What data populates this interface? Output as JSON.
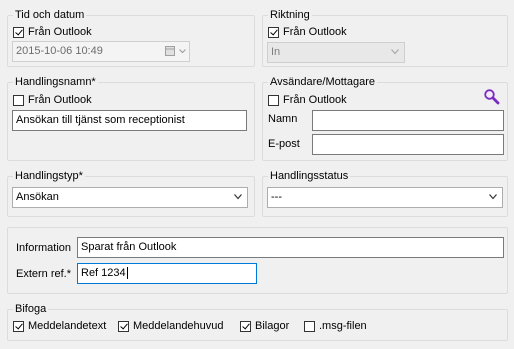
{
  "tid_och_datum": {
    "title": "Tid och datum",
    "from_outlook_label": "Från Outlook",
    "from_outlook_checked": true,
    "datetime_value": "2015-10-06 10:49"
  },
  "riktning": {
    "title": "Riktning",
    "from_outlook_label": "Från Outlook",
    "from_outlook_checked": true,
    "direction_value": "In"
  },
  "handlingsnamn": {
    "title": "Handlingsnamn*",
    "from_outlook_label": "Från Outlook",
    "from_outlook_checked": false,
    "name_value": "Ansökan till tjänst som receptionist"
  },
  "avsandare": {
    "title": "Avsändare/Mottagare",
    "from_outlook_label": "Från Outlook",
    "from_outlook_checked": false,
    "name_label": "Namn",
    "name_value": "",
    "email_label": "E-post",
    "email_value": "",
    "search_icon": "search-icon"
  },
  "handlingstyp": {
    "title": "Handlingstyp*",
    "selected": "Ansökan"
  },
  "handlingsstatus": {
    "title": "Handlingsstatus",
    "selected": "---"
  },
  "info": {
    "information_label": "Information",
    "information_value": "Sparat från Outlook",
    "extern_ref_label": "Extern ref.*",
    "extern_ref_value": "Ref 1234"
  },
  "bifoga": {
    "title": "Bifoga",
    "items": [
      {
        "label": "Meddelandetext",
        "checked": true
      },
      {
        "label": "Meddelandehuvud",
        "checked": true
      },
      {
        "label": "Bilagor",
        "checked": true
      },
      {
        "label": ".msg-filen",
        "checked": false
      }
    ]
  },
  "colors": {
    "background": "#f0f0f0",
    "focus_border": "#0078d7",
    "search_icon": "#7b2cbf"
  }
}
